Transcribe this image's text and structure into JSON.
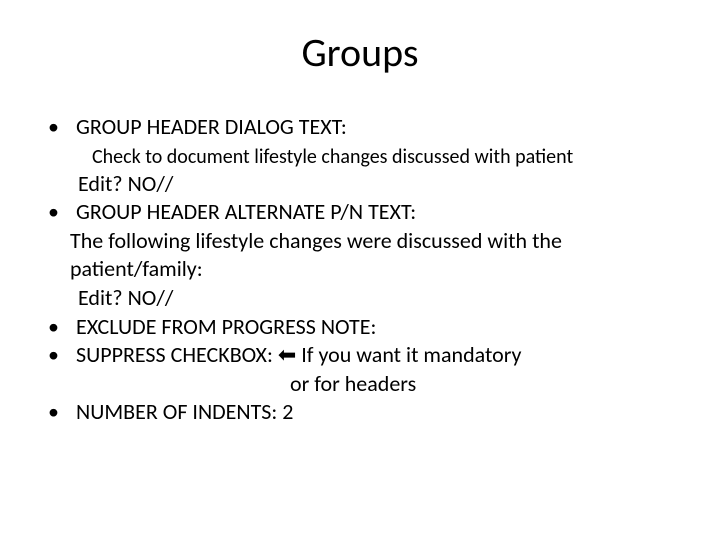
{
  "title": "Groups",
  "items": {
    "header_dialog": {
      "label": "GROUP HEADER DIALOG TEXT:",
      "sub": "Check to document lifestyle changes discussed with patient",
      "edit": "Edit? NO//"
    },
    "alternate_pn": {
      "label": "GROUP HEADER ALTERNATE P/N TEXT:",
      "desc": "The following lifestyle changes were discussed with the patient/family:",
      "edit": "Edit? NO//"
    },
    "exclude": {
      "label": "EXCLUDE FROM PROGRESS NOTE:"
    },
    "suppress": {
      "label_part1": "SUPPRESS CHECKBOX: ",
      "arrow": "⬅",
      "label_part2": " If you want it mandatory",
      "or_line": "or for headers"
    },
    "indents": {
      "label": "NUMBER OF INDENTS: 2"
    }
  }
}
